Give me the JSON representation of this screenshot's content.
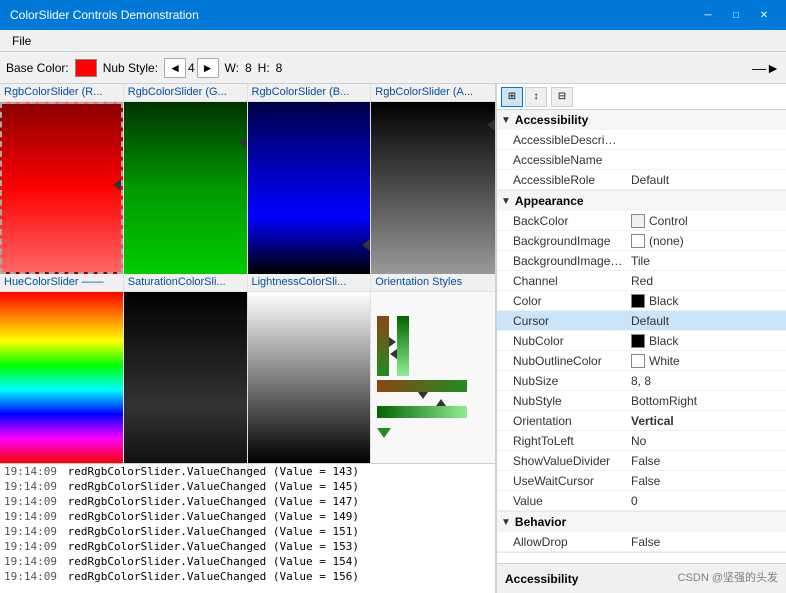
{
  "window": {
    "title": "ColorSlider Controls Demonstration",
    "min_label": "─",
    "max_label": "□",
    "close_label": "✕"
  },
  "menu": {
    "file_label": "File"
  },
  "toolbar": {
    "base_color_label": "Base Color:",
    "nub_style_label": "Nub Style:",
    "nub_style_value": "4",
    "arrow_left": "◄",
    "arrow_right": "►",
    "w_label": "W:",
    "w_value": "8",
    "h_label": "H:",
    "h_value": "8"
  },
  "sliders": {
    "row1": [
      {
        "header": "RgbColorSlider (R...",
        "type": "red"
      },
      {
        "header": "RgbColorSlider (G...",
        "type": "green"
      },
      {
        "header": "RgbColorSlider (B...",
        "type": "blue"
      },
      {
        "header": "RgbColorSlider (A...",
        "type": "alpha"
      }
    ],
    "row2": [
      {
        "header": "HueColorSlider",
        "type": "hue"
      },
      {
        "header": "SaturationColorSli...",
        "type": "saturation"
      },
      {
        "header": "LightnessColorSli...",
        "type": "lightness"
      },
      {
        "header": "Orientation Styles",
        "type": "orientation"
      }
    ]
  },
  "log": {
    "entries": [
      {
        "time": "19:14:09",
        "text": "redRgbColorSlider.ValueChanged (Value = 143)"
      },
      {
        "time": "19:14:09",
        "text": "redRgbColorSlider.ValueChanged (Value = 145)"
      },
      {
        "time": "19:14:09",
        "text": "redRgbColorSlider.ValueChanged (Value = 147)"
      },
      {
        "time": "19:14:09",
        "text": "redRgbColorSlider.ValueChanged (Value = 149)"
      },
      {
        "time": "19:14:09",
        "text": "redRgbColorSlider.ValueChanged (Value = 151)"
      },
      {
        "time": "19:14:09",
        "text": "redRgbColorSlider.ValueChanged (Value = 153)"
      },
      {
        "time": "19:14:09",
        "text": "redRgbColorSlider.ValueChanged (Value = 154)"
      },
      {
        "time": "19:14:09",
        "text": "redRgbColorSlider.ValueChanged (Value = 156)"
      }
    ]
  },
  "properties": {
    "toolbar_buttons": [
      "⊞",
      "↕",
      "⊟"
    ],
    "sections": [
      {
        "name": "Accessibility",
        "expanded": true,
        "rows": [
          {
            "name": "AccessibleDescription",
            "value": "",
            "has_swatch": false
          },
          {
            "name": "AccessibleName",
            "value": "",
            "has_swatch": false
          },
          {
            "name": "AccessibleRole",
            "value": "Default",
            "has_swatch": false
          }
        ]
      },
      {
        "name": "Appearance",
        "expanded": true,
        "rows": [
          {
            "name": "BackColor",
            "value": "Control",
            "has_swatch": true,
            "swatch_color": "#f0f0f0"
          },
          {
            "name": "BackgroundImage",
            "value": "(none)",
            "has_swatch": true,
            "swatch_color": "#fff"
          },
          {
            "name": "BackgroundImageLayc",
            "value": "Tile",
            "has_swatch": false
          },
          {
            "name": "Channel",
            "value": "Red",
            "has_swatch": false
          },
          {
            "name": "Color",
            "value": "Black",
            "has_swatch": true,
            "swatch_color": "#000"
          },
          {
            "name": "Cursor",
            "value": "Default",
            "has_swatch": false,
            "selected": true
          },
          {
            "name": "NubColor",
            "value": "Black",
            "has_swatch": true,
            "swatch_color": "#000"
          },
          {
            "name": "NubOutlineColor",
            "value": "White",
            "has_swatch": true,
            "swatch_color": "#fff"
          },
          {
            "name": "NubSize",
            "value": "8, 8",
            "has_swatch": false
          },
          {
            "name": "NubStyle",
            "value": "BottomRight",
            "has_swatch": false
          },
          {
            "name": "Orientation",
            "value": "Vertical",
            "has_swatch": false,
            "bold_value": true
          },
          {
            "name": "RightToLeft",
            "value": "No",
            "has_swatch": false
          },
          {
            "name": "ShowValueDivider",
            "value": "False",
            "has_swatch": false
          },
          {
            "name": "UseWaitCursor",
            "value": "False",
            "has_swatch": false
          },
          {
            "name": "Value",
            "value": "0",
            "has_swatch": false
          }
        ]
      },
      {
        "name": "Behavior",
        "expanded": true,
        "rows": [
          {
            "name": "AllowDrop",
            "value": "False",
            "has_swatch": false
          }
        ]
      }
    ],
    "footer": "Accessibility"
  },
  "watermark": "CSDN @坚强的头发"
}
